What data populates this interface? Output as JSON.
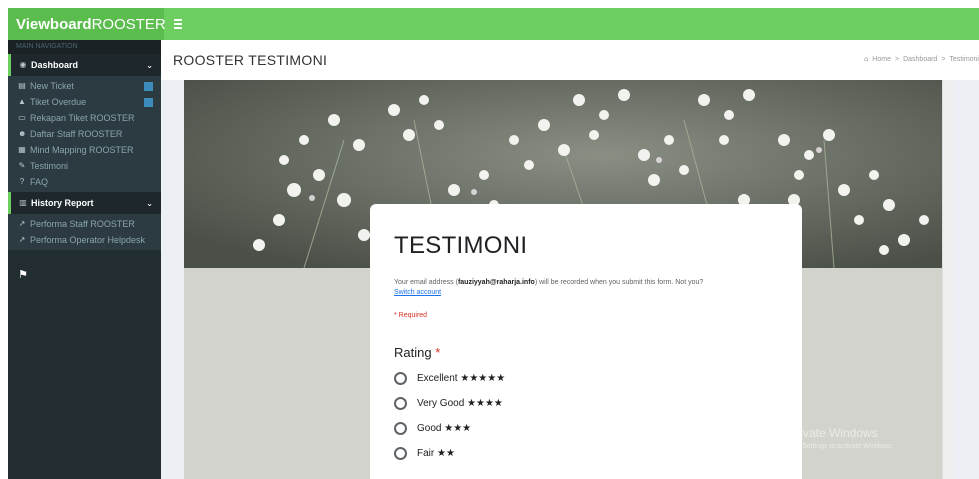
{
  "header": {
    "brand_bold": "Viewboard",
    "brand_light": "ROOSTER",
    "menu_icon": "hamburger-icon"
  },
  "sidebar": {
    "nav_header": "MAIN NAVIGATION",
    "dashboard": {
      "label": "Dashboard",
      "icon": "dashboard-icon",
      "items": [
        {
          "label": "New Ticket",
          "icon": "ticket-icon",
          "badge": true
        },
        {
          "label": "Tiket Overdue",
          "icon": "warning-icon",
          "badge": true
        },
        {
          "label": "Rekapan Tiket ROOSTER",
          "icon": "folder-icon",
          "badge": false
        },
        {
          "label": "Daftar Staff ROOSTER",
          "icon": "users-icon",
          "badge": false
        },
        {
          "label": "Mind Mapping ROOSTER",
          "icon": "sitemap-icon",
          "badge": false
        },
        {
          "label": "Testimoni",
          "icon": "edit-icon",
          "badge": false
        },
        {
          "label": "FAQ",
          "icon": "question-icon",
          "badge": false
        }
      ]
    },
    "history": {
      "label": "History Report",
      "icon": "chart-icon",
      "items": [
        {
          "label": "Performa Staff ROOSTER",
          "icon": "line-chart-icon"
        },
        {
          "label": "Performa Operator Helpdesk",
          "icon": "line-chart-icon"
        }
      ]
    }
  },
  "content": {
    "page_title": "ROOSTER TESTIMONI",
    "breadcrumb": [
      "Home",
      ">",
      "Dashboard",
      ">",
      "Testimoni"
    ]
  },
  "form": {
    "title": "TESTIMONI",
    "email_prefix": "Your email address (",
    "email": "fauziyyah@raharja.info",
    "email_suffix": ") will be recorded when you submit this form. Not you?",
    "switch_account": "Switch account",
    "required_note": "* Required",
    "question": "Rating",
    "question_star": "*",
    "options": [
      "Excellent ★★★★★",
      "Very Good ★★★★",
      "Good ★★★",
      "Fair ★★"
    ]
  },
  "watermark": {
    "line1": "Activate Windows",
    "line2": "Go to Settings to activate Windows."
  },
  "colors": {
    "topbar": "#6dcf5f",
    "sidebar": "#222d32",
    "banner": "#6d7268"
  }
}
